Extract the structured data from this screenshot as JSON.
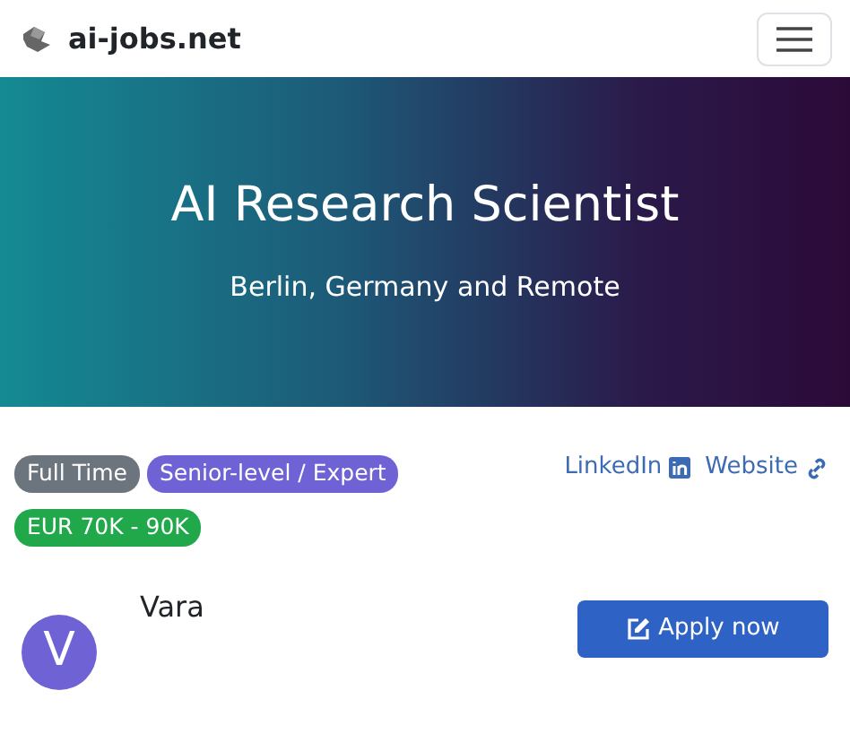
{
  "navbar": {
    "brand": "ai-jobs.net"
  },
  "hero": {
    "title": "AI Research Scientist",
    "location": "Berlin, Germany and Remote"
  },
  "tags": [
    {
      "label": "Full Time",
      "color": "#6c757d"
    },
    {
      "label": "Senior-level / Expert",
      "color": "#6f62d4"
    },
    {
      "label": "EUR 70K - 90K",
      "color": "#20a84a"
    }
  ],
  "links": [
    {
      "label": "LinkedIn",
      "kind": "linkedin"
    },
    {
      "label": "Website",
      "kind": "website"
    }
  ],
  "company": {
    "initial": "V",
    "name": "Vara"
  },
  "apply": {
    "label": "Apply now"
  }
}
